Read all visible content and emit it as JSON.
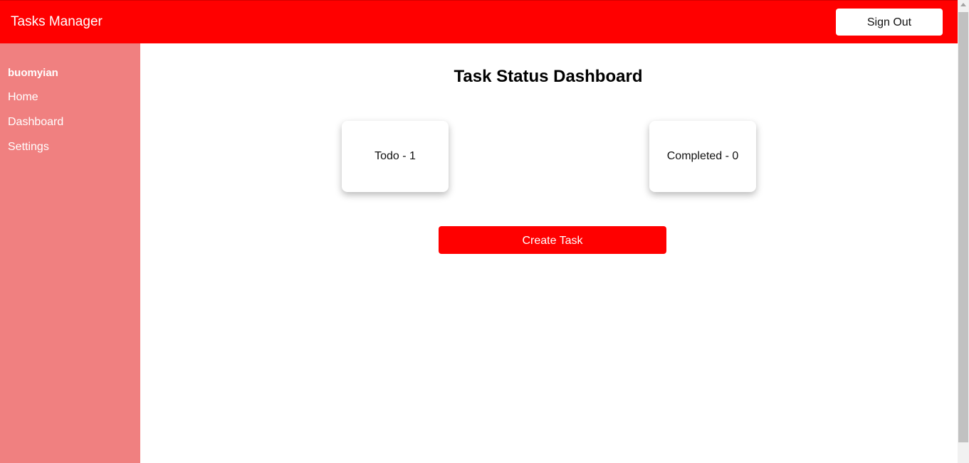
{
  "header": {
    "app_title": "Tasks Manager",
    "sign_out_label": "Sign Out"
  },
  "sidebar": {
    "username": "buomyian",
    "items": [
      {
        "label": "Home"
      },
      {
        "label": "Dashboard"
      },
      {
        "label": "Settings"
      }
    ]
  },
  "main": {
    "title": "Task Status Dashboard",
    "cards": [
      {
        "label": "Todo - 1"
      },
      {
        "label": "Completed - 0"
      }
    ],
    "create_button_label": "Create Task"
  },
  "colors": {
    "brand": "#ff0000",
    "sidebar": "#f08080",
    "text": "#000000"
  }
}
